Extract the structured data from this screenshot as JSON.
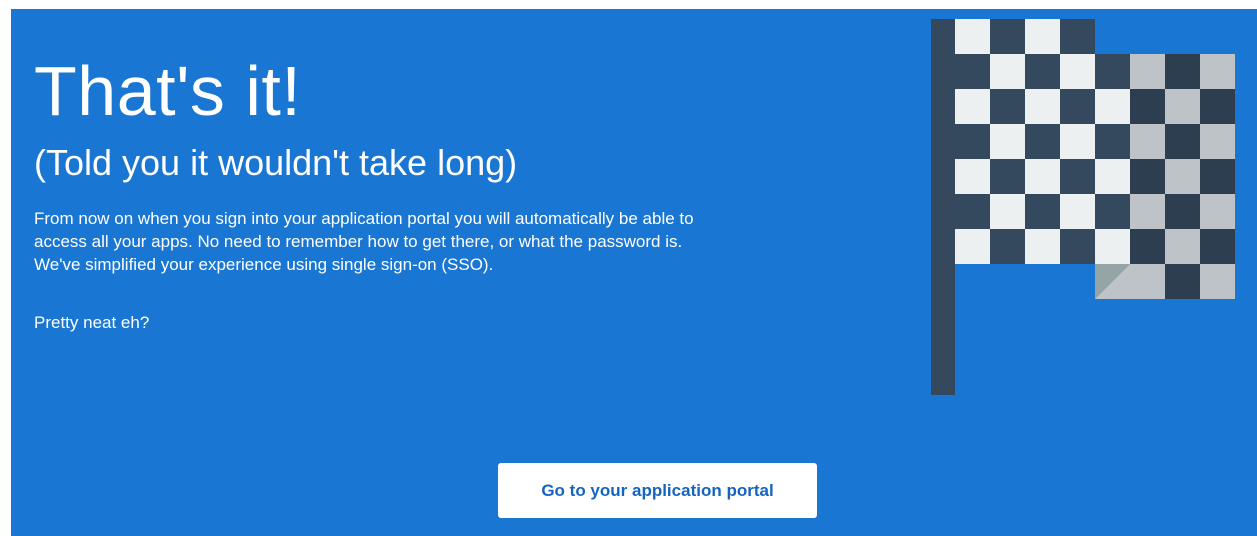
{
  "hero": {
    "title": "That's it!",
    "subtitle": "(Told you it wouldn't take long)",
    "body_lines": [
      "From now on when you sign into your application portal you will automatically be able to",
      "access all your apps. No need to remember how to get there, or what the password is.",
      "We've simplified your experience using single sign-on (SSO)."
    ],
    "tagline": "Pretty neat eh?"
  },
  "actions": {
    "portal_button_label": "Go to your application portal"
  },
  "illustration": {
    "icon": "checkered-flag-icon",
    "colors": {
      "background": "#1976d2",
      "pole": "#34495e",
      "dark_square": "#34495e",
      "light_square": "#ecf0f1",
      "shaded_dark": "#2c3e50",
      "shaded_light": "#bdc3c7",
      "fold": "#95a5a6"
    }
  }
}
